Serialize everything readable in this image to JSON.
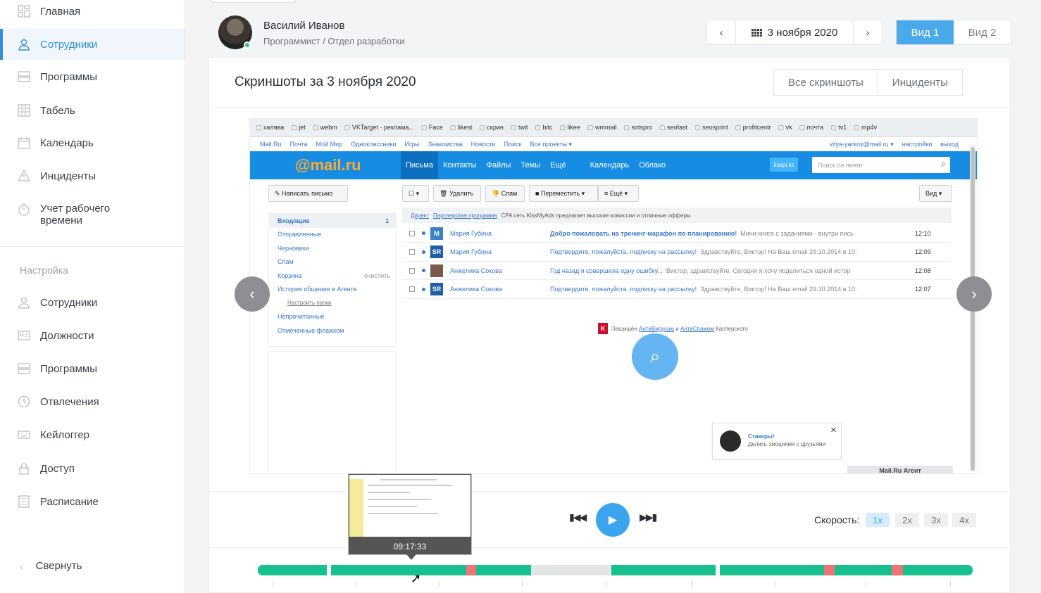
{
  "sidebar": {
    "items": [
      {
        "label": "Главная",
        "icon": "dashboard-icon"
      },
      {
        "label": "Сотрудники",
        "icon": "user-icon",
        "active": true
      },
      {
        "label": "Программы",
        "icon": "programs-icon"
      },
      {
        "label": "Табель",
        "icon": "timesheet-icon"
      },
      {
        "label": "Календарь",
        "icon": "calendar-icon"
      },
      {
        "label": "Инциденты",
        "icon": "warning-icon"
      },
      {
        "label": "Учет рабочего времени",
        "icon": "stopwatch-icon"
      }
    ],
    "settings_title": "Настройка",
    "settings_items": [
      {
        "label": "Сотрудники",
        "icon": "user-icon"
      },
      {
        "label": "Должности",
        "icon": "id-card-icon"
      },
      {
        "label": "Программы",
        "icon": "programs-icon"
      },
      {
        "label": "Отвлечения",
        "icon": "distraction-icon"
      },
      {
        "label": "Кейлоггер",
        "icon": "keyboard-icon"
      },
      {
        "label": "Доступ",
        "icon": "lock-icon"
      },
      {
        "label": "Расписание",
        "icon": "schedule-icon"
      }
    ],
    "collapse": "Свернуть"
  },
  "header": {
    "user_name": "Василий Иванов",
    "user_role": "Программист / Отдел разработки",
    "date": "3 ноября 2020",
    "view1": "Вид 1",
    "view2": "Вид 2"
  },
  "card": {
    "title": "Скриншоты за 3 ноября 2020",
    "tab_all": "Все скриншоты",
    "tab_incidents": "Инциденты"
  },
  "screenshot": {
    "bookmarks": [
      "халява",
      "jet",
      "webm",
      "VKTarget - реклама...",
      "Face",
      "likest",
      "скрин",
      "twit",
      "bitc",
      "likee",
      "wmmail",
      "sotspro",
      "seofast",
      "seosprint",
      "profitcentr",
      "vk",
      "почта",
      "tv1",
      "mp4v"
    ],
    "top_links": [
      "Mail.Ru",
      "Почта",
      "Мой Мир",
      "Одноклассники",
      "Игры",
      "Знакомства",
      "Новости",
      "Поиск",
      "Все проекты ▾"
    ],
    "top_right": [
      "vitya-yarkov@mail.ru ▾",
      "настройки",
      "выход"
    ],
    "logo": "@mail.ru",
    "nav": [
      "Письма",
      "Контакты",
      "Файлы",
      "Темы",
      "Ещё"
    ],
    "nav_extra": [
      "Календарь",
      "Облако"
    ],
    "kaspi": "kaspi.kz",
    "search_placeholder": "Поиск по почте",
    "toolbar": {
      "compose": "Написать письмо",
      "delete": "Удалить",
      "spam": "Спам",
      "move": "Переместить ▾",
      "more": "≡ Ещё ▾",
      "view": "Вид ▾"
    },
    "folders": [
      {
        "label": "Входящие",
        "count": "1"
      },
      {
        "label": "Отправленные"
      },
      {
        "label": "Черновики"
      },
      {
        "label": "Спам"
      },
      {
        "label": "Корзина",
        "extra": "очистить"
      },
      {
        "label": "История общения в Агенте"
      },
      {
        "label": "Настроить папки"
      },
      {
        "label": "Непрочитанные"
      },
      {
        "label": "Отмеченные флажком"
      }
    ],
    "ad": {
      "label": "Директ",
      "link": "Партнерская программа",
      "text": "CPA сеть KissMyAds предлагает высокие комиссии и отличные офферы"
    },
    "messages": [
      {
        "from": "Мария Губина",
        "avatar": "M",
        "subject": "Добро пожаловать на тренинг-марафон по планированию!",
        "preview": "Мини-книга с заданиями - внутри пись",
        "time": "12:10",
        "bold": true
      },
      {
        "from": "Мария Губина",
        "avatar": "SR",
        "subject": "Подтвердите, пожалуйста, подписку на рассылку!",
        "preview": "Здравствуйте, Виктор! На Ваш email 29.10.2014 в 10:",
        "time": "12:09"
      },
      {
        "from": "Анжелика Сокова",
        "avatar": "",
        "subject": "Год назад я совершила одну ошибку...",
        "preview": "Виктор, здравствуйте. Сегодня я хочу поделиться одной истор",
        "time": "12:08"
      },
      {
        "from": "Анжелика Сокова",
        "avatar": "SR",
        "subject": "Подтвердите, пожалуйста, подписку на рассылку!",
        "preview": "Здравствуйте, Виктор! На Ваш email 29.10.2014 в 10:",
        "time": "12:07"
      }
    ],
    "kaspersky": {
      "prefix": "Защищён",
      "link1": "АнтиВирусом",
      "mid": "и",
      "link2": "АнтиСпамом",
      "suffix": "Касперского"
    },
    "sticker_title": "Стикеры!",
    "sticker_text": "Делись эмоциями с друзьями",
    "agent": "Mail.Ru Агент"
  },
  "player": {
    "speed_label": "Скорость:",
    "speeds": [
      "1x",
      "2x",
      "3x",
      "4x"
    ],
    "active_speed": "1x",
    "tooltip_time": "09:17:33"
  },
  "colors": {
    "accent": "#3aa5ee",
    "active": "#16c08f",
    "incident": "#f07474",
    "idle": "#e4e5e7"
  }
}
